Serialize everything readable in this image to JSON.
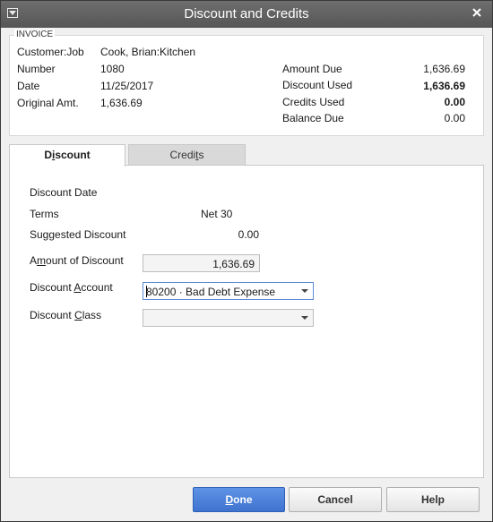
{
  "window": {
    "title": "Discount and Credits"
  },
  "invoice": {
    "section_label": "INVOICE",
    "customer_job_label": "Customer:Job",
    "customer_job": "Cook, Brian:Kitchen",
    "number_label": "Number",
    "number": "1080",
    "date_label": "Date",
    "date": "11/25/2017",
    "original_amt_label": "Original Amt.",
    "original_amt": "1,636.69",
    "amount_due_label": "Amount Due",
    "amount_due": "1,636.69",
    "discount_used_label": "Discount Used",
    "discount_used": "1,636.69",
    "credits_used_label": "Credits Used",
    "credits_used": "0.00",
    "balance_due_label": "Balance Due",
    "balance_due": "0.00"
  },
  "tabs": {
    "discount": {
      "pre": "D",
      "ul": "i",
      "post": "scount"
    },
    "credits": {
      "pre": "Credi",
      "ul": "t",
      "post": "s"
    }
  },
  "discount": {
    "discount_date_label": "Discount Date",
    "terms_label": "Terms",
    "terms": "Net 30",
    "suggested_label": "Suggested Discount",
    "suggested": "0.00",
    "amount_label": {
      "pre": "A",
      "ul": "m",
      "post": "ount of Discount"
    },
    "amount_value": "1,636.69",
    "account_label": {
      "pre": "Discount ",
      "ul": "A",
      "post": "ccount"
    },
    "account_value": "80200 · Bad Debt Expense",
    "class_label": {
      "pre": "Discount ",
      "ul": "C",
      "post": "lass"
    },
    "class_value": ""
  },
  "buttons": {
    "done": {
      "ul": "D",
      "post": "one"
    },
    "cancel": "Cancel",
    "help": "Help"
  },
  "colors": {
    "primary_button": "#4a7fdc",
    "title_bar": "#5f5f5f"
  }
}
